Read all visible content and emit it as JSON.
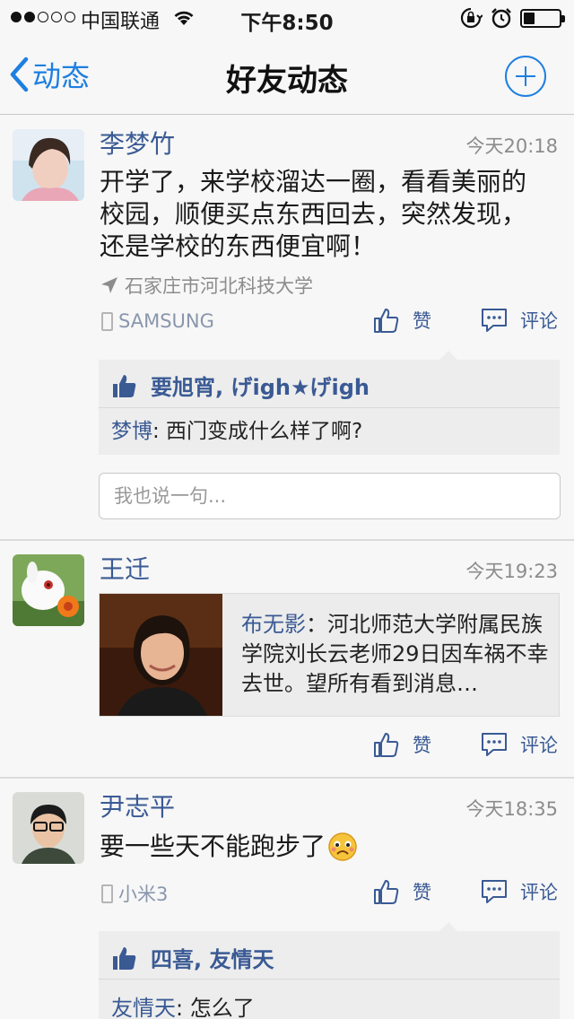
{
  "status_bar": {
    "carrier": "中国联通",
    "time": "下午8:50"
  },
  "nav": {
    "back_label": "动态",
    "title": "好友动态"
  },
  "posts": [
    {
      "author": "李梦竹",
      "time": "今天20:18",
      "text": "开学了，来学校溜达一圈，看看美丽的校园，顺便买点东西回去，突然发现，还是学校的东西便宜啊！",
      "location": "石家庄市河北科技大学",
      "device": "SAMSUNG",
      "like_label": "赞",
      "comment_label": "评论",
      "likers": "要旭宵, げigh★げigh",
      "comments": [
        {
          "name": "梦博",
          "text": ": 西门变成什么样了啊?"
        }
      ],
      "input_placeholder": "我也说一句..."
    },
    {
      "author": "王迁",
      "time": "今天19:23",
      "share_name": "布无影",
      "share_text": "：河北师范大学附属民族学院刘长云老师29日因车祸不幸去世。望所有看到消息…",
      "like_label": "赞",
      "comment_label": "评论"
    },
    {
      "author": "尹志平",
      "time": "今天18:35",
      "text": "要一些天不能跑步了",
      "device": "小米3",
      "like_label": "赞",
      "comment_label": "评论",
      "likers": "四喜, 友情天",
      "comments": [
        {
          "name": "友情天",
          "text": ": 怎么了"
        }
      ]
    }
  ],
  "colors": {
    "accent": "#1e7fe0",
    "name_blue": "#3a5a94",
    "meta_gray": "#8c8c8c",
    "background": "#f7f7f7"
  }
}
